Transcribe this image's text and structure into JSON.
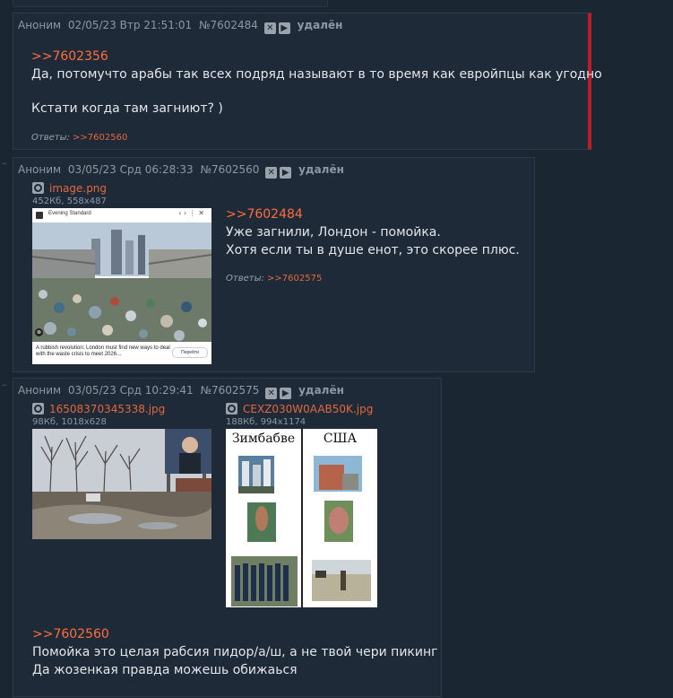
{
  "posts": [
    {
      "header": {
        "author": "Аноним",
        "date": "02/05/23 Втр 21:51:01",
        "num": "№7602484",
        "deleted": "удалён"
      },
      "quote_link": ">>7602356",
      "lines": [
        "Да, потомучто арабы так всех подряд называют в то время как евройпцы как угодно",
        "Кстати когда там загниют? )"
      ],
      "replies_label": "Ответы:",
      "replies": [
        ">>7602560"
      ]
    },
    {
      "header": {
        "author": "Аноним",
        "date": "03/05/23 Срд 06:28:33",
        "num": "№7602560",
        "deleted": "удалён"
      },
      "file": {
        "name": "image.png",
        "meta": "452Кб, 558x487",
        "thumb_header": "Evening Standard",
        "thumb_caption": "A rubbish revolution: London must find new ways to deal with the waste crisis to meet 2026...",
        "thumb_button": "Перейти"
      },
      "quote_link": ">>7602484",
      "lines": [
        "Уже загнили, Лондон - помойка.",
        "Хотя если ты в душе енот, это скорее плюс."
      ],
      "replies_label": "Ответы:",
      "replies": [
        ">>7602575"
      ]
    },
    {
      "header": {
        "author": "Аноним",
        "date": "03/05/23 Срд 10:29:41",
        "num": "№7602575",
        "deleted": "удалён"
      },
      "files": [
        {
          "name": "16508370345338.jpg",
          "meta": "98Кб, 1018x628"
        },
        {
          "name": "CEXZ030W0AAB50K.jpg",
          "meta": "188Кб, 994x1174",
          "col_left": "Зимбабве",
          "col_right": "США"
        }
      ],
      "quote_link": ">>7602560",
      "lines": [
        "Помойка это целая рабсия пидор/а/ш, а не твой чери пикинг",
        "Да жозенкая правда можешь обижаься"
      ]
    }
  ],
  "icons": {
    "close": "close-icon",
    "play": "play-icon",
    "search": "magnifier-icon"
  },
  "colors": {
    "background": "#1b2633",
    "post_bg": "#1e2a38",
    "link": "#ff6e3b",
    "highlight_border": "#b81f2a"
  }
}
